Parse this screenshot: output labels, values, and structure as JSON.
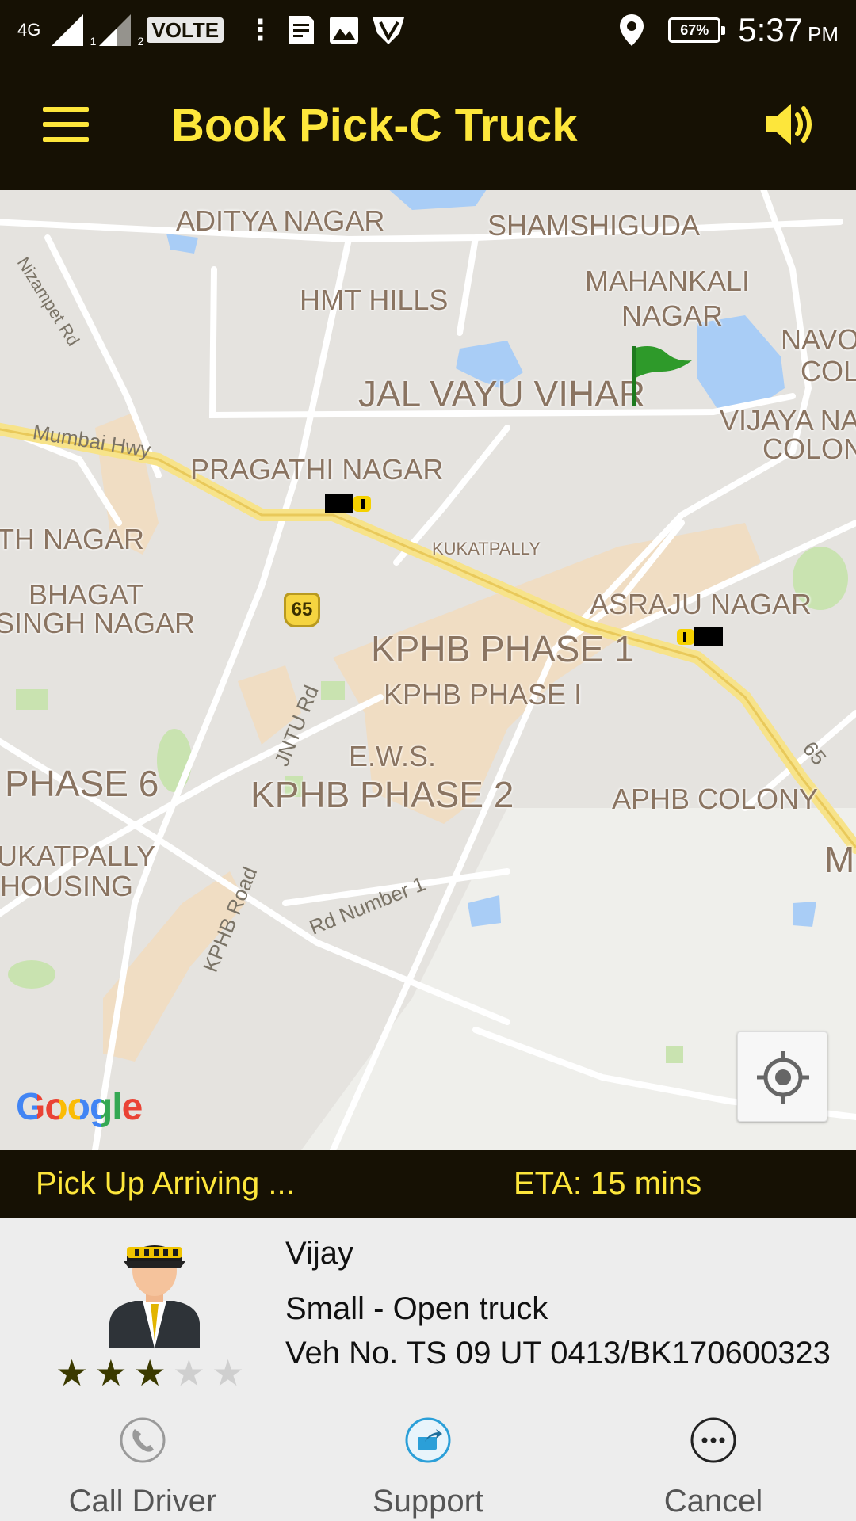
{
  "status_bar": {
    "network": "4G",
    "sim1": "1",
    "sim2": "2",
    "volte": "VOLTE",
    "overflow": "⋮",
    "battery": "67%",
    "time": "5:37",
    "ampm": "PM"
  },
  "app_bar": {
    "title": "Book Pick-C Truck"
  },
  "map": {
    "areas": [
      {
        "name": "ADITYA NAGAR"
      },
      {
        "name": "SHAMSHIGUDA"
      },
      {
        "name": "MAHANKALI"
      },
      {
        "name": "NAGAR"
      },
      {
        "name": "HMT HILLS"
      },
      {
        "name": "NAVO"
      },
      {
        "name": "COL"
      },
      {
        "name": "JAL VAYU VIHAR"
      },
      {
        "name": "VIJAYA NA"
      },
      {
        "name": "COLON"
      },
      {
        "name": "PRAGATHI NAGAR"
      },
      {
        "name": "TH NAGAR"
      },
      {
        "name": "KUKATPALLY"
      },
      {
        "name": "BHAGAT"
      },
      {
        "name": "SINGH NAGAR"
      },
      {
        "name": "ASRAJU NAGAR"
      },
      {
        "name": "KPHB PHASE 1"
      },
      {
        "name": "KPHB PHASE I"
      },
      {
        "name": "E.W.S."
      },
      {
        "name": "PHASE 6"
      },
      {
        "name": "KPHB PHASE 2"
      },
      {
        "name": "APHB COLONY"
      },
      {
        "name": "UKATPALLY"
      },
      {
        "name": "HOUSING"
      },
      {
        "name": "MI"
      }
    ],
    "roads": {
      "nizampet": "Nizampet Rd",
      "mumbai": "Mumbai Hwy",
      "jntu": "JNTU Rd",
      "kphb": "KPHB Road",
      "rd1": "Rd Number 1",
      "hwy65b": "65"
    },
    "highway_shield": "65",
    "google": "Google"
  },
  "pickup": {
    "status": "Pick Up Arriving ...",
    "eta": "ETA: 15 mins"
  },
  "driver": {
    "name": "Vijay",
    "truck_type": "Small - Open truck",
    "vehicle_no": "Veh No. TS 09 UT 0413/BK170600323",
    "rating": 3,
    "rating_max": 5
  },
  "actions": {
    "call": "Call Driver",
    "support": "Support",
    "cancel": "Cancel"
  },
  "colors": {
    "bar_bg": "#161104",
    "accent": "#fde63b",
    "panel_bg": "#ededed",
    "star_filled": "#3b3a00",
    "star_empty": "#cfcfcf",
    "support_blue": "#2b9fd8"
  }
}
